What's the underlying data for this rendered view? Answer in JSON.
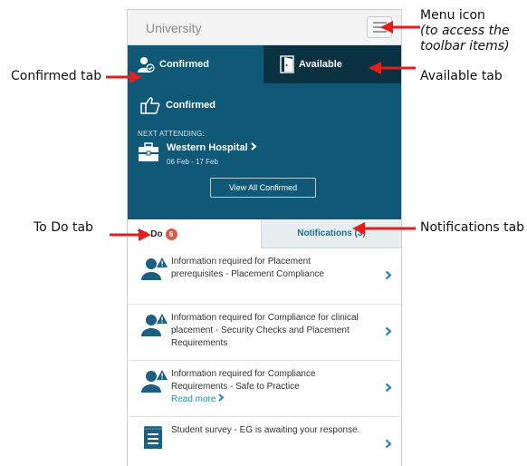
{
  "annotations": {
    "menu_title": "Menu icon",
    "menu_note_line1": "(to access the",
    "menu_note_line2": "toolbar items)",
    "confirmed": "Confirmed tab",
    "available": "Available tab",
    "todo": "To Do tab",
    "notifications": "Notifications tab"
  },
  "header": {
    "title": "University"
  },
  "tabs": {
    "confirmed": "Confirmed",
    "available": "Available"
  },
  "confirmed_panel": {
    "heading": "Confirmed",
    "next_label": "NEXT ATTENDING:",
    "hospital": "Western Hospital",
    "dates": "06 Feb - 17 Feb",
    "view_button": "View All Confirmed"
  },
  "lower_tabs": {
    "todo": "To Do",
    "todo_count": "6",
    "notifications": "Notifications (3)"
  },
  "items": [
    {
      "text": "Information required for Placement prerequisites - Placement Compliance",
      "icon": "person-alert-icon"
    },
    {
      "text": "Information required for Compliance for clinical placement - Security Checks and Placement Requirements",
      "icon": "person-alert-icon"
    },
    {
      "text": "Information required for Compliance Requirements - Safe to Practice",
      "link": "Read more",
      "icon": "person-alert-icon"
    },
    {
      "text": "Student survey - EG is awaiting your response.",
      "icon": "survey-icon"
    }
  ],
  "colors": {
    "hero": "#0f5876",
    "available_tab": "#0a3140",
    "badge": "#e05a45",
    "link": "#2a84b8",
    "arrow": "#e0201c"
  }
}
